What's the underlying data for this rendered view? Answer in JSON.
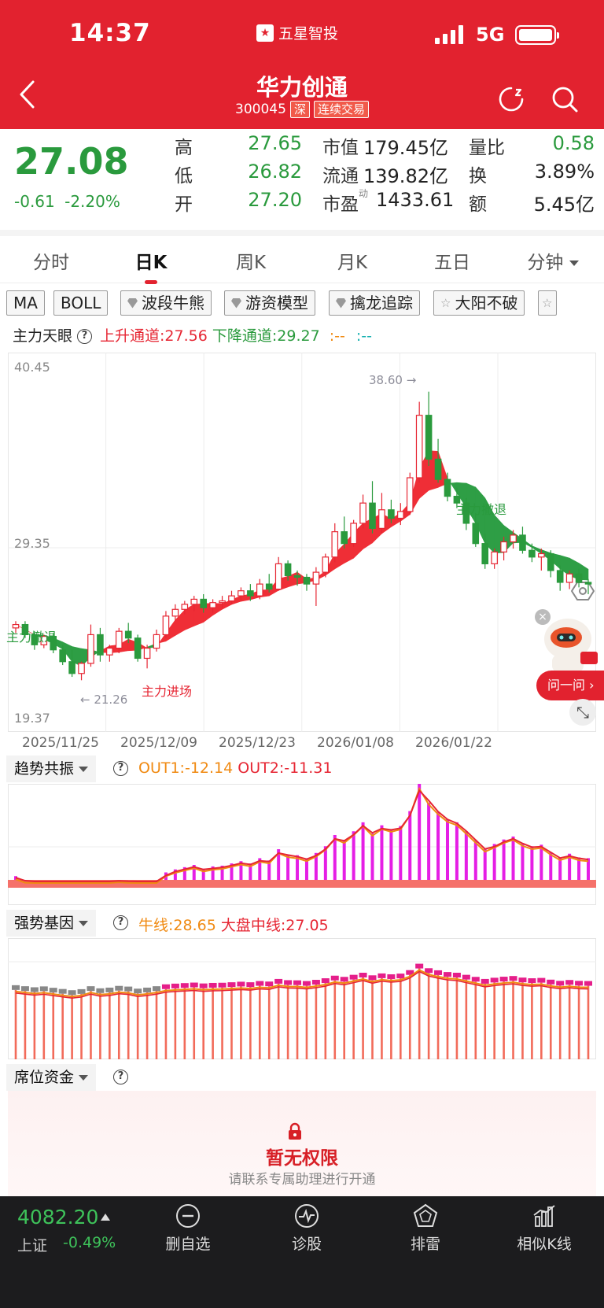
{
  "status_bar": {
    "time": "14:37",
    "app_name": "五星智投",
    "network": "5G"
  },
  "header": {
    "stock_name": "华力创通",
    "stock_code": "300045",
    "market_tag": "深",
    "trade_tag": "连续交易"
  },
  "quote": {
    "price": "27.08",
    "change": "-0.61",
    "change_pct": "-2.20%",
    "high_label": "高",
    "high": "27.65",
    "low_label": "低",
    "low": "26.82",
    "open_label": "开",
    "open": "27.20",
    "mcap_label": "市值",
    "mcap": "179.45亿",
    "float_label": "流通",
    "float": "139.82亿",
    "pe_label": "市盈",
    "pe_sup": "动",
    "pe": "1433.61",
    "vol_ratio_label": "量比",
    "vol_ratio": "0.58",
    "turnover_label": "换",
    "turnover": "3.89%",
    "amount_label": "额",
    "amount": "5.45亿"
  },
  "tabs": [
    {
      "label": "分时"
    },
    {
      "label": "日K"
    },
    {
      "label": "周K"
    },
    {
      "label": "月K"
    },
    {
      "label": "五日"
    },
    {
      "label": "分钟"
    }
  ],
  "indicators": [
    "MA",
    "BOLL",
    "波段牛熊",
    "游资模型",
    "擒龙追踪",
    "大阳不破"
  ],
  "main_legend": {
    "name": "主力天眼",
    "up": "上升通道:27.56",
    "down": "下降通道:29.27",
    "a": ":--",
    "b": ":--"
  },
  "chart_labels": {
    "retreat1": "主力撤退",
    "retreat2": "主力撤退",
    "enter": "主力进场",
    "max_note": "38.60 →",
    "min_note": "← 21.26"
  },
  "chart_data": {
    "type": "candlestick",
    "ylim": [
      19.37,
      40.45
    ],
    "y_ticks": [
      "40.45",
      "29.35",
      "19.37"
    ],
    "x_ticks": [
      "2025/11/25",
      "2025/12/09",
      "2025/12/23",
      "2026/01/08",
      "2026/01/22"
    ],
    "max": 38.6,
    "min": 21.26,
    "candles": [
      [
        24.6,
        25.0,
        24.3,
        24.8
      ],
      [
        24.8,
        25.0,
        24.0,
        24.2
      ],
      [
        24.2,
        24.4,
        23.3,
        23.6
      ],
      [
        23.6,
        24.2,
        23.4,
        24.1
      ],
      [
        24.1,
        24.3,
        23.1,
        23.3
      ],
      [
        23.3,
        23.6,
        22.4,
        22.6
      ],
      [
        22.6,
        23.3,
        21.7,
        21.9
      ],
      [
        21.9,
        22.6,
        21.5,
        22.5
      ],
      [
        22.5,
        24.8,
        22.3,
        24.2
      ],
      [
        24.2,
        24.6,
        22.6,
        23.0
      ],
      [
        23.0,
        23.6,
        22.6,
        23.4
      ],
      [
        23.4,
        24.6,
        23.1,
        24.4
      ],
      [
        24.4,
        24.9,
        23.7,
        24.0
      ],
      [
        24.0,
        24.2,
        22.6,
        22.8
      ],
      [
        22.8,
        23.6,
        22.2,
        23.4
      ],
      [
        23.4,
        24.5,
        23.2,
        24.2
      ],
      [
        24.2,
        25.6,
        24.0,
        25.3
      ],
      [
        25.3,
        26.0,
        25.0,
        25.7
      ],
      [
        25.7,
        26.2,
        25.4,
        26.0
      ],
      [
        26.0,
        26.5,
        25.6,
        26.3
      ],
      [
        26.3,
        26.6,
        25.5,
        25.8
      ],
      [
        25.8,
        26.3,
        25.5,
        26.1
      ],
      [
        26.1,
        26.5,
        25.8,
        26.2
      ],
      [
        26.2,
        26.8,
        26.0,
        26.5
      ],
      [
        26.5,
        27.0,
        26.2,
        26.8
      ],
      [
        26.8,
        27.2,
        26.2,
        26.5
      ],
      [
        26.5,
        27.5,
        26.3,
        27.2
      ],
      [
        27.2,
        27.8,
        26.7,
        26.9
      ],
      [
        26.9,
        28.8,
        26.8,
        28.4
      ],
      [
        28.4,
        28.6,
        27.4,
        27.7
      ],
      [
        27.7,
        28.0,
        27.1,
        27.6
      ],
      [
        27.6,
        27.8,
        26.8,
        27.2
      ],
      [
        27.2,
        28.2,
        25.9,
        27.9
      ],
      [
        27.9,
        29.0,
        27.6,
        28.8
      ],
      [
        28.8,
        30.8,
        28.5,
        30.3
      ],
      [
        30.3,
        31.2,
        29.3,
        29.6
      ],
      [
        29.6,
        31.0,
        29.4,
        30.8
      ],
      [
        30.8,
        32.5,
        30.5,
        32.0
      ],
      [
        32.0,
        33.3,
        30.2,
        30.5
      ],
      [
        30.5,
        32.6,
        30.2,
        31.6
      ],
      [
        31.6,
        32.2,
        30.8,
        31.1
      ],
      [
        31.1,
        32.0,
        30.7,
        31.5
      ],
      [
        31.5,
        33.8,
        31.3,
        33.5
      ],
      [
        33.5,
        38.0,
        33.2,
        37.2
      ],
      [
        37.2,
        38.6,
        34.2,
        34.6
      ],
      [
        34.6,
        35.8,
        33.2,
        33.4
      ],
      [
        33.4,
        33.8,
        32.1,
        32.4
      ],
      [
        32.4,
        32.9,
        31.7,
        32.0
      ],
      [
        32.0,
        32.3,
        30.4,
        30.8
      ],
      [
        30.8,
        31.4,
        29.4,
        29.6
      ],
      [
        29.6,
        30.2,
        28.1,
        28.4
      ],
      [
        28.4,
        29.3,
        28.1,
        29.1
      ],
      [
        29.1,
        30.0,
        28.6,
        29.7
      ],
      [
        29.7,
        30.4,
        29.3,
        30.1
      ],
      [
        30.1,
        30.6,
        29.0,
        29.2
      ],
      [
        29.2,
        29.6,
        28.5,
        28.8
      ],
      [
        28.8,
        29.3,
        28.0,
        29.0
      ],
      [
        29.0,
        29.2,
        27.6,
        28.0
      ],
      [
        28.0,
        28.3,
        26.8,
        27.3
      ],
      [
        27.3,
        28.0,
        26.9,
        27.8
      ],
      [
        27.8,
        28.1,
        27.0,
        27.3
      ],
      [
        27.3,
        27.5,
        26.6,
        27.2
      ]
    ]
  },
  "panel2": {
    "name": "趋势共振",
    "out1": "OUT1:-12.14",
    "out2": "OUT2:-11.31"
  },
  "panel3": {
    "name": "强势基因",
    "cow": "牛线:28.65",
    "mid": "大盘中线:27.05"
  },
  "panel4": {
    "name": "席位资金",
    "lock_title": "暂无权限",
    "lock_sub": "请联系专属助理进行开通"
  },
  "float_widget": {
    "ask_label": "问一问 ›"
  },
  "bottom_bar": {
    "index_value": "4082.20",
    "index_name": "上证",
    "index_change": "-0.49%",
    "items": [
      {
        "label": "删自选"
      },
      {
        "label": "诊股"
      },
      {
        "label": "排雷"
      },
      {
        "label": "相似K线"
      }
    ]
  },
  "colors": {
    "brand": "#e2222f",
    "up": "#e62633",
    "down": "#2a9a3d",
    "magenta": "#e51ee5"
  }
}
